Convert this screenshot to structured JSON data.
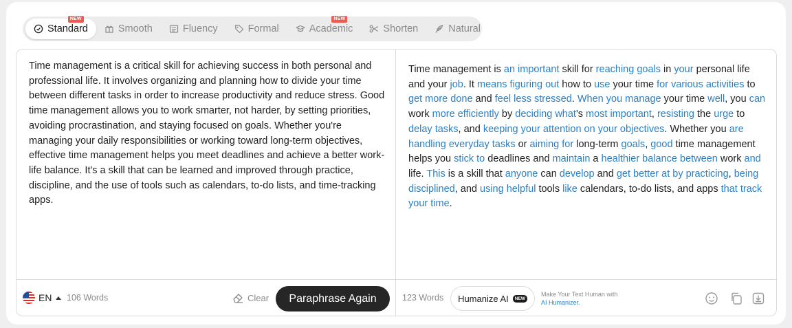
{
  "modes": [
    {
      "label": "Standard",
      "icon": "shield-check-icon",
      "active": true,
      "badge": "NEW"
    },
    {
      "label": "Smooth",
      "icon": "gift-icon",
      "active": false
    },
    {
      "label": "Fluency",
      "icon": "document-icon",
      "active": false
    },
    {
      "label": "Formal",
      "icon": "tag-icon",
      "active": false
    },
    {
      "label": "Academic",
      "icon": "graduation-cap-icon",
      "active": false,
      "badge": "NEW"
    },
    {
      "label": "Shorten",
      "icon": "scissors-icon",
      "active": false
    },
    {
      "label": "Natural",
      "icon": "feather-icon",
      "active": false
    }
  ],
  "input": {
    "text": "Time management is a critical skill for achieving success in both personal and professional life. It involves organizing and planning how to divide your time between different tasks in order to increase productivity and reduce stress. Good time management allows you to work smarter, not harder, by setting priorities, avoiding procrastination, and staying focused on goals. Whether you're managing your daily responsibilities or working toward long-term objectives, effective time management helps you meet deadlines and achieve a better work-life balance. It's a skill that can be learned and improved through practice, discipline, and the use of tools such as calendars, to-do lists, and time-tracking apps.",
    "language": "EN",
    "word_count": "106 Words",
    "clear_label": "Clear",
    "paraphrase_label": "Paraphrase Again"
  },
  "output": {
    "segments": [
      {
        "t": "Time management is ",
        "c": false
      },
      {
        "t": "an important",
        "c": true
      },
      {
        "t": " skill for ",
        "c": false
      },
      {
        "t": "reaching goals",
        "c": true
      },
      {
        "t": " in ",
        "c": false
      },
      {
        "t": "your",
        "c": true
      },
      {
        "t": " personal life and your ",
        "c": false
      },
      {
        "t": "job",
        "c": true
      },
      {
        "t": ". It ",
        "c": false
      },
      {
        "t": "means figuring out",
        "c": true
      },
      {
        "t": " how to ",
        "c": false
      },
      {
        "t": "use",
        "c": true
      },
      {
        "t": " your time ",
        "c": false
      },
      {
        "t": "for various activities",
        "c": true
      },
      {
        "t": " to ",
        "c": false
      },
      {
        "t": "get more done",
        "c": true
      },
      {
        "t": " and ",
        "c": false
      },
      {
        "t": "feel less stressed",
        "c": true
      },
      {
        "t": ". ",
        "c": false
      },
      {
        "t": "When you manage",
        "c": true
      },
      {
        "t": " your time ",
        "c": false
      },
      {
        "t": "well",
        "c": true
      },
      {
        "t": ", you ",
        "c": false
      },
      {
        "t": "can",
        "c": true
      },
      {
        "t": " work ",
        "c": false
      },
      {
        "t": "more efficiently",
        "c": true
      },
      {
        "t": " by ",
        "c": false
      },
      {
        "t": "deciding what",
        "c": true
      },
      {
        "t": "'s ",
        "c": false
      },
      {
        "t": "most important",
        "c": true
      },
      {
        "t": ", ",
        "c": false
      },
      {
        "t": "resisting",
        "c": true
      },
      {
        "t": " the ",
        "c": false
      },
      {
        "t": "urge",
        "c": true
      },
      {
        "t": " to ",
        "c": false
      },
      {
        "t": "delay tasks",
        "c": true
      },
      {
        "t": ", and ",
        "c": false
      },
      {
        "t": "keeping your attention on your objectives",
        "c": true
      },
      {
        "t": ". Whether you ",
        "c": false
      },
      {
        "t": "are handling everyday tasks",
        "c": true
      },
      {
        "t": " or ",
        "c": false
      },
      {
        "t": "aiming for",
        "c": true
      },
      {
        "t": " long-term ",
        "c": false
      },
      {
        "t": "goals",
        "c": true
      },
      {
        "t": ", ",
        "c": false
      },
      {
        "t": "good",
        "c": true
      },
      {
        "t": " time management helps you ",
        "c": false
      },
      {
        "t": "stick to",
        "c": true
      },
      {
        "t": " deadlines and ",
        "c": false
      },
      {
        "t": "maintain",
        "c": true
      },
      {
        "t": " a ",
        "c": false
      },
      {
        "t": "healthier balance between",
        "c": true
      },
      {
        "t": " work ",
        "c": false
      },
      {
        "t": "and",
        "c": true
      },
      {
        "t": " life. ",
        "c": false
      },
      {
        "t": "This",
        "c": true
      },
      {
        "t": " is a skill that ",
        "c": false
      },
      {
        "t": "anyone",
        "c": true
      },
      {
        "t": " can ",
        "c": false
      },
      {
        "t": "develop",
        "c": true
      },
      {
        "t": " and ",
        "c": false
      },
      {
        "t": "get better at by practicing",
        "c": true
      },
      {
        "t": ", ",
        "c": false
      },
      {
        "t": "being disciplined",
        "c": true
      },
      {
        "t": ", and ",
        "c": false
      },
      {
        "t": "using helpful",
        "c": true
      },
      {
        "t": " tools ",
        "c": false
      },
      {
        "t": "like",
        "c": true
      },
      {
        "t": " calendars, to-do lists, and apps ",
        "c": false
      },
      {
        "t": "that track your time",
        "c": true
      },
      {
        "t": ".",
        "c": false
      }
    ],
    "word_count": "123 Words",
    "humanize_label": "Humanize AI",
    "humanize_badge": "NEW",
    "promo_line1": "Make Your Text Human with",
    "promo_link": "AI Humanizer."
  },
  "colors": {
    "changed_word": "#2a7fc6",
    "primary_button": "#262626",
    "new_badge": "#f05a4f"
  }
}
